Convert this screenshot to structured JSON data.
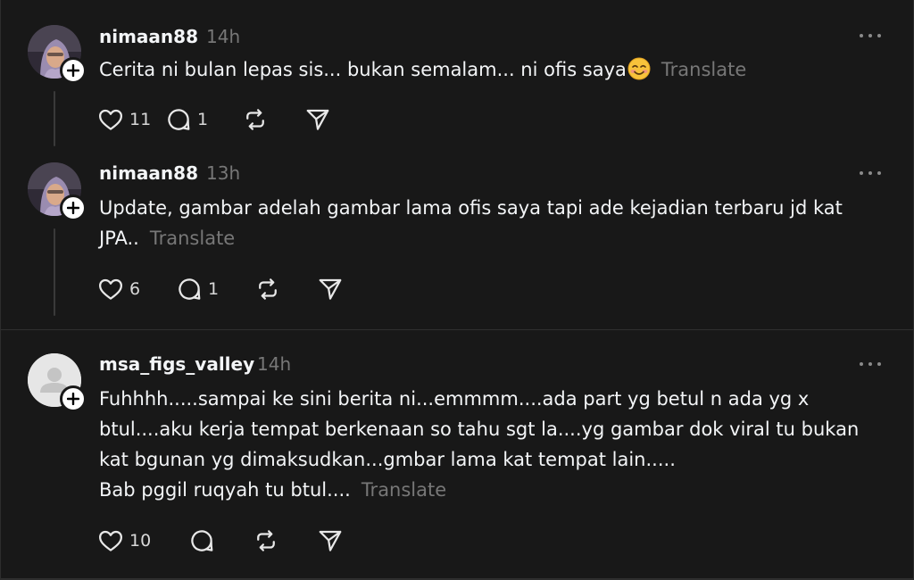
{
  "posts": [
    {
      "username": "nimaan88",
      "time": "14h",
      "text": "Cerita ni bulan lepas sis... bukan semalam... ni ofis saya",
      "emoji": "smiling-face-emoji",
      "translate": "Translate",
      "likes": "11",
      "replies": "1"
    },
    {
      "username": "nimaan88",
      "time": "13h",
      "text": "Update, gambar adelah gambar lama ofis saya tapi ade kejadian terbaru jd kat JPA..",
      "translate": "Translate",
      "likes": "6",
      "replies": "1"
    },
    {
      "username": "msa_figs_valley",
      "time": "14h",
      "text_lines": [
        "Fuhhhh.....sampai ke sini berita ni...emmmm....ada part yg betul n ada yg x",
        "btul....aku kerja tempat berkenaan so tahu sgt la....yg gambar dok viral tu bukan",
        "kat bgunan yg dimaksudkan...gmbar lama kat tempat lain.....",
        "Bab pggil ruqyah tu btul...."
      ],
      "translate": "Translate",
      "likes": "10"
    }
  ],
  "icons": {
    "like": "heart-icon",
    "reply": "comment-icon",
    "repost": "repost-icon",
    "share": "send-icon",
    "more": "more-icon",
    "follow": "plus-icon"
  },
  "colors": {
    "background": "#181818",
    "text": "#f3f5f7",
    "secondary": "#777777",
    "divider": "#2f2f2f"
  }
}
